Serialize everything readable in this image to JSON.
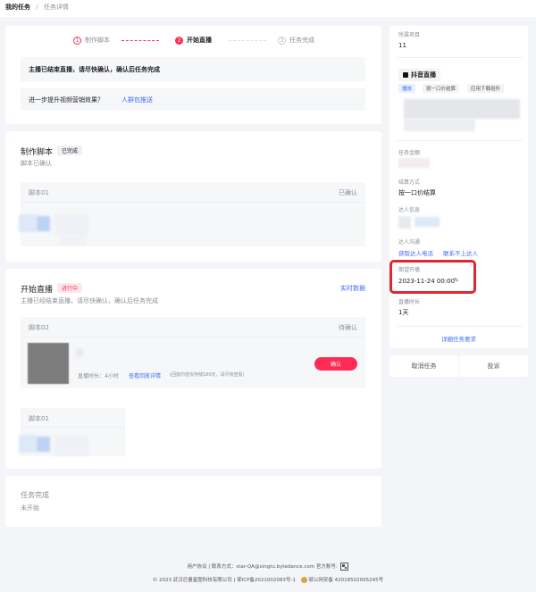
{
  "breadcrumb": {
    "root": "我的任务",
    "sep": "/",
    "current": "任务详情"
  },
  "steps": [
    {
      "num": "1",
      "label": "制作脚本"
    },
    {
      "num": "2",
      "label": "开始直播"
    },
    {
      "num": "3",
      "label": "任务完成"
    }
  ],
  "notice": {
    "text": "主播已结束直播，请尽快确认，确认后任务完成"
  },
  "promo": {
    "text": "进一步提升视频营销效果？",
    "link": "人群包推送"
  },
  "script_section": {
    "title": "制作脚本",
    "badge": "已完成",
    "subtitle": "脚本已确认",
    "item_title": "脚本01",
    "item_status": "已确认"
  },
  "live_section": {
    "title": "开始直播",
    "badge": "进行中",
    "subtitle": "主播已经结束直播，请尽快确认，确认后任务完成",
    "realtime": "实时数据",
    "item_title": "脚本02",
    "item_status": "待确认",
    "duration": "直播时长：4小时",
    "replay_link": "查看回放详情",
    "replay_note": "(回放内容仅存储180天，请尽快查看)",
    "confirm": "确认",
    "item2_title": "脚本01"
  },
  "complete_section": {
    "title": "任务完成",
    "subtitle": "未开始"
  },
  "side": {
    "project_label": "所属项目",
    "project_value": "11",
    "platform_tag": "抖音直播",
    "tags": [
      "播放",
      "按一口价结算",
      "应用下载组件"
    ],
    "amount_label": "任务金额",
    "settle_label": "结算方式",
    "settle_value": "按一口价结算",
    "talent_label": "达人信息",
    "contact_label": "达人沟通",
    "contact_link1": "获取达人电话",
    "contact_link2": "联系不上达人",
    "expect_label": "期望开播",
    "expect_value": "2023-11-24 00:00",
    "duration_label": "直播时长",
    "duration_value": "1天",
    "detail_link": "详细任务要求",
    "cancel_btn": "取消任务",
    "complain_btn": "投诉"
  },
  "footer": {
    "line1": "用户协议 | 联系方式：star-QA@xingtu.bytedance.com  官方账号:",
    "line2": "© 2023 武汉巨量星图科技有限公司 | 鄂ICP备2021002083号-1",
    "police": "鄂公网安备 42018502005245号"
  },
  "colors": {
    "accent": "#fe2c55",
    "link": "#3f6ef5",
    "highlight_box": "#e0262f"
  }
}
